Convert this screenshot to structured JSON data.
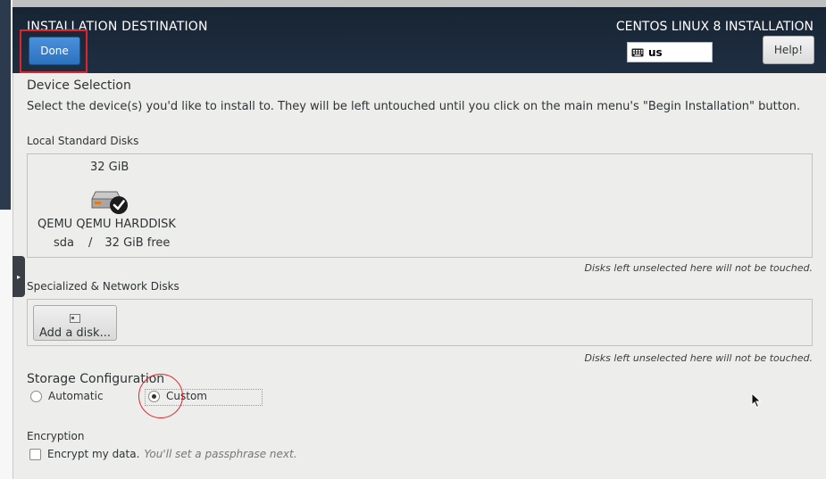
{
  "header": {
    "title": "INSTALLATION DESTINATION",
    "done_label": "Done",
    "product": "CENTOS LINUX 8 INSTALLATION",
    "keyboard_layout": "us",
    "help_label": "Help!"
  },
  "device_selection": {
    "heading": "Device Selection",
    "description": "Select the device(s) you'd like to install to.  They will be left untouched until you click on the main menu's \"Begin Installation\" button."
  },
  "local_disks": {
    "heading": "Local Standard Disks",
    "disk": {
      "size": "32 GiB",
      "name": "QEMU QEMU HARDDISK",
      "device": "sda",
      "separator": "/",
      "free": "32 GiB free",
      "selected": true
    },
    "note": "Disks left unselected here will not be touched."
  },
  "network_disks": {
    "heading": "Specialized & Network Disks",
    "add_label": "Add a disk...",
    "note": "Disks left unselected here will not be touched."
  },
  "storage": {
    "heading": "Storage Configuration",
    "automatic_label": "Automatic",
    "custom_label": "Custom",
    "selected": "Custom"
  },
  "encryption": {
    "heading": "Encryption",
    "checkbox_label": "Encrypt my data.",
    "hint": "You'll set a passphrase next.",
    "checked": false
  },
  "colors": {
    "header_bg": "#1b2a3a",
    "done_blue": "#3584e4",
    "highlight_red": "#e0242d",
    "content_bg": "#ededeb"
  }
}
